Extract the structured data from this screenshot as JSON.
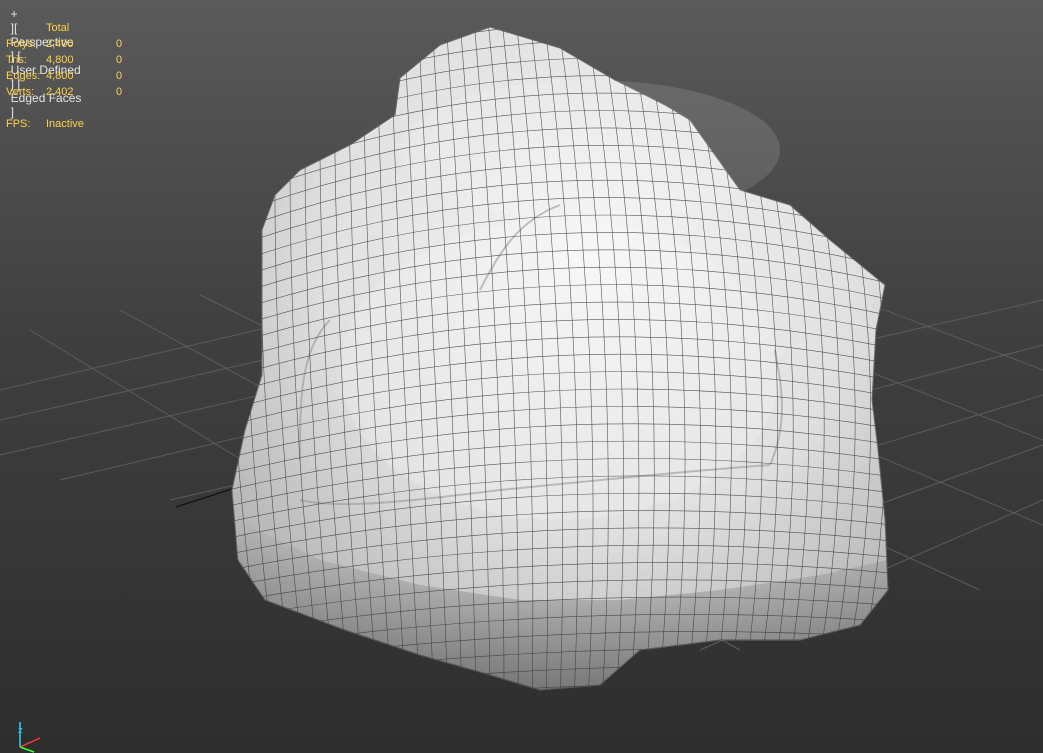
{
  "viewport": {
    "label_parts": [
      "+",
      "Perspective",
      "User Defined",
      "Edged Faces"
    ]
  },
  "stats": {
    "header": "Total",
    "rows": [
      {
        "label": "Polys:",
        "total": "2,400",
        "selected": "0"
      },
      {
        "label": "Tris:",
        "total": "4,800",
        "selected": "0"
      },
      {
        "label": "Edges:",
        "total": "4,800",
        "selected": "0"
      },
      {
        "label": "Verts:",
        "total": "2,402",
        "selected": "0"
      }
    ],
    "fps_label": "FPS:",
    "fps_value": "Inactive"
  },
  "colors": {
    "stats_text": "#ffd24a",
    "label_text": "#e6e6e6",
    "mesh_fill": "#e2e2e2",
    "wire": "#3a3a3a",
    "grid": "#5c5c5c"
  },
  "icons": [
    "axis-tripod-icon"
  ]
}
